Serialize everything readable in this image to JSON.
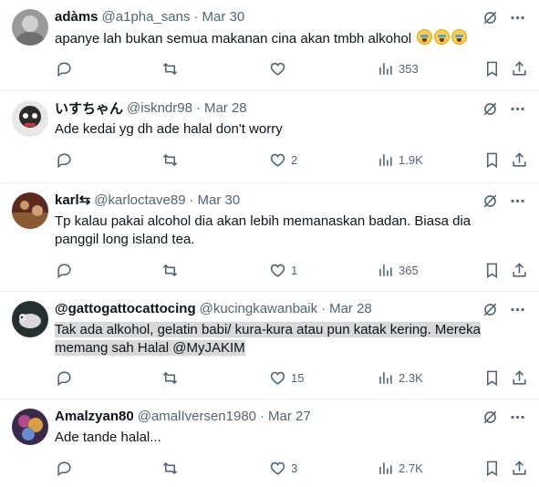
{
  "tweets": [
    {
      "name": "adàms",
      "handle": "@a1pha_sans",
      "sep": "·",
      "date": "Mar 30",
      "text": "apanye lah bukan semua makanan cina akan tmbh alkohol",
      "emoji": [
        "sobbing-face",
        "sobbing-face",
        "sobbing-face"
      ],
      "replies": "",
      "reposts": "",
      "likes": "",
      "views": "353",
      "avatar_color": "#8a8a8a"
    },
    {
      "name": "いすちゃん",
      "handle": "@iskndr98",
      "sep": "·",
      "date": "Mar 28",
      "text": "Ade kedai yg dh ade halal don't worry",
      "replies": "",
      "reposts": "",
      "likes": "2",
      "views": "1.9K",
      "avatar_color": "#2b2b2b"
    },
    {
      "name": "karl⇆",
      "handle": "@karloctave89",
      "sep": "·",
      "date": "Mar 30",
      "text": "Tp kalau pakai alcohol dia akan lebih memanaskan badan. Biasa dia panggil long island tea.",
      "replies": "",
      "reposts": "",
      "likes": "1",
      "views": "365",
      "avatar_color": "#7a3a2a"
    },
    {
      "name": "@gattogattocattocing",
      "handle": "@kucingkawanbaik",
      "sep": "·",
      "date": "Mar 28",
      "text_line1": "Tak ada alkohol, gelatin babi/ kura-kura atau pun katak kering. Mereka",
      "text_line2": "memang sah Halal @MyJAKIM",
      "replies": "",
      "reposts": "",
      "likes": "15",
      "views": "2.3K",
      "avatar_color": "#2f3a3a"
    },
    {
      "name": "Amalzyan80",
      "handle": "@amalIversen1980",
      "sep": "·",
      "date": "Mar 27",
      "text": "Ade tande halal...",
      "replies": "",
      "reposts": "",
      "likes": "3",
      "views": "2.7K",
      "avatar_color": "#7a5aa0"
    }
  ],
  "colors": {
    "text": "#0f1419",
    "muted": "#536471",
    "border": "#eff3f4",
    "highlight": "#d8d8d8"
  },
  "icons": [
    "reply-icon",
    "repost-icon",
    "like-icon",
    "views-icon",
    "bookmark-icon",
    "share-icon",
    "grok-icon",
    "more-icon"
  ]
}
